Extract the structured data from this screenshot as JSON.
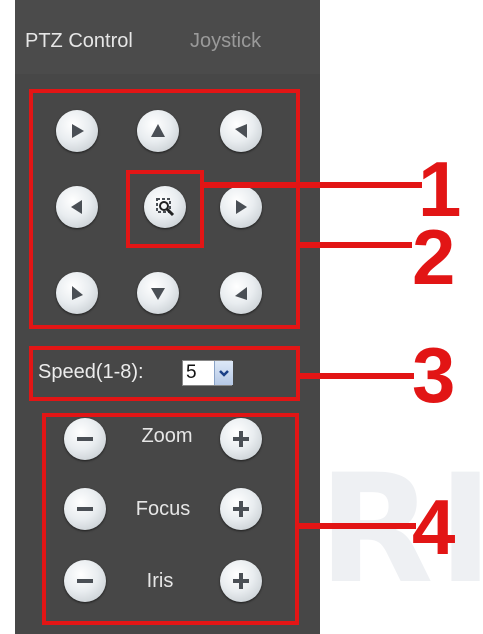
{
  "tabs": [
    {
      "label": "PTZ Control",
      "active": true
    },
    {
      "label": "Joystick",
      "active": false
    }
  ],
  "direction_pad": [
    {
      "name": "up-left",
      "icon": "arrow-up-left-icon"
    },
    {
      "name": "up",
      "icon": "arrow-up-icon"
    },
    {
      "name": "up-right",
      "icon": "arrow-up-right-icon"
    },
    {
      "name": "left",
      "icon": "arrow-left-icon"
    },
    {
      "name": "center",
      "icon": "zoom-select-icon"
    },
    {
      "name": "right",
      "icon": "arrow-right-icon"
    },
    {
      "name": "down-left",
      "icon": "arrow-down-left-icon"
    },
    {
      "name": "down",
      "icon": "arrow-down-icon"
    },
    {
      "name": "down-right",
      "icon": "arrow-down-right-icon"
    }
  ],
  "speed": {
    "label": "Speed(1-8):",
    "value": "5"
  },
  "lens_controls": [
    {
      "label": "Zoom"
    },
    {
      "label": "Focus"
    },
    {
      "label": "Iris"
    }
  ],
  "callouts": [
    "1",
    "2",
    "3",
    "4"
  ],
  "colors": {
    "panel": "#474747",
    "highlight": "#e21515",
    "button": "#e9edf0",
    "icon": "#4a4f55"
  }
}
